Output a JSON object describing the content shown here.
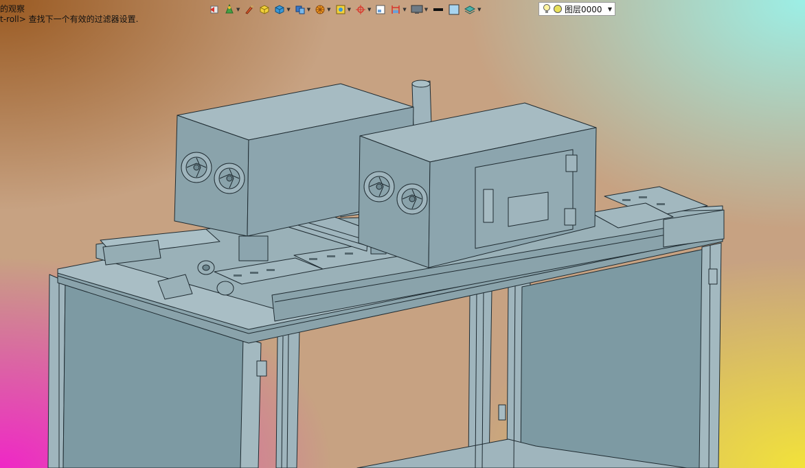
{
  "command_line": {
    "line1": "的观察",
    "line2": "t-roll> 查找下一个有效的过滤器设置."
  },
  "toolbar": {
    "buttons": [
      {
        "icon": "view-back-icon"
      },
      {
        "icon": "render-icon"
      },
      {
        "icon": "brush-icon"
      },
      {
        "icon": "box-yellow-icon"
      },
      {
        "icon": "box-blue-icon"
      },
      {
        "icon": "box-multi-icon"
      },
      {
        "icon": "orange-wheel-icon"
      },
      {
        "icon": "view-frame-icon"
      },
      {
        "icon": "target-icon"
      },
      {
        "icon": "panel-icon"
      },
      {
        "icon": "dimension-icon"
      },
      {
        "icon": "monitor-icon"
      },
      {
        "icon": "line-weight-icon"
      },
      {
        "icon": "color-swatch-icon"
      },
      {
        "icon": "layers-stack-icon"
      }
    ],
    "layer": {
      "name": "图层0000",
      "bulb_icon": "bulb-icon",
      "sun_icon": "sun-icon"
    }
  },
  "model": {
    "body_color": "#8ca5ae",
    "edge_color": "#1e2a30",
    "rail_color": "#9fb7bf"
  }
}
